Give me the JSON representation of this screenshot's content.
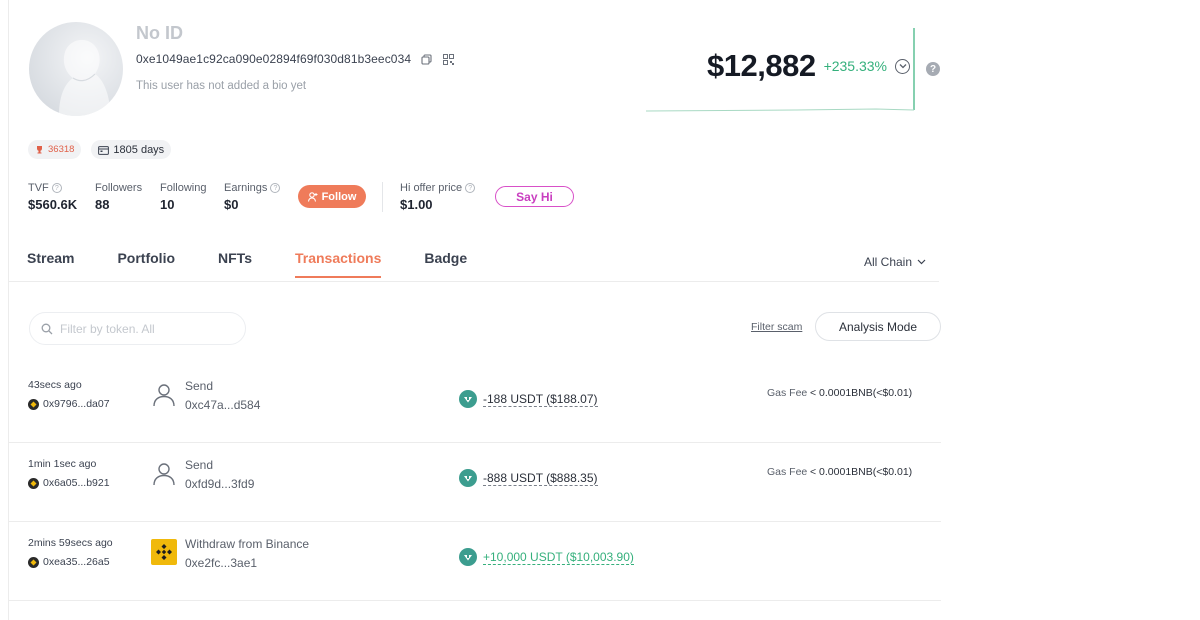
{
  "profile": {
    "name": "No ID",
    "address": "0xe1049ae1c92ca090e02894f69f030d81b3eec034",
    "bio": "This user has not added a bio yet",
    "rank": "36318",
    "days": "1805 days"
  },
  "stats": [
    {
      "label": "TVF",
      "value": "$560.6K",
      "has_help": true
    },
    {
      "label": "Followers",
      "value": "88",
      "has_help": false
    },
    {
      "label": "Following",
      "value": "10",
      "has_help": false
    },
    {
      "label": "Earnings",
      "value": "$0",
      "has_help": true
    }
  ],
  "follow_label": "Follow",
  "offer": {
    "label": "Hi offer price",
    "value": "$1.00"
  },
  "sayhi_label": "Say Hi",
  "net_worth": {
    "value": "$12,882",
    "change": "+235.33%",
    "change_color": "#35b07c"
  },
  "tabs": [
    {
      "label": "Stream",
      "active": false
    },
    {
      "label": "Portfolio",
      "active": false
    },
    {
      "label": "NFTs",
      "active": false
    },
    {
      "label": "Transactions",
      "active": true
    },
    {
      "label": "Badge",
      "active": false
    }
  ],
  "chain_selector": "All Chain",
  "search": {
    "placeholder": "Filter by token. All"
  },
  "filter_scam": "Filter scam",
  "analysis_mode": "Analysis Mode",
  "transactions": [
    {
      "time": "43secs ago",
      "from": "0x9796...da07",
      "type": "Send",
      "counterparty": "0xc47a...d584",
      "icon": "user-icon",
      "amount": "-188 USDT ($188.07)",
      "positive": false,
      "gas_label": "Gas Fee",
      "gas_value": "< 0.0001BNB(<$0.01)"
    },
    {
      "time": "1min 1sec ago",
      "from": "0x6a05...b921",
      "type": "Send",
      "counterparty": "0xfd9d...3fd9",
      "icon": "user-icon",
      "amount": "-888 USDT ($888.35)",
      "positive": false,
      "gas_label": "Gas Fee",
      "gas_value": "< 0.0001BNB(<$0.01)"
    },
    {
      "time": "2mins 59secs ago",
      "from": "0xea35...26a5",
      "type": "Withdraw from Binance",
      "counterparty": "0xe2fc...3ae1",
      "icon": "binance-icon",
      "amount": "+10,000 USDT ($10,003.90)",
      "positive": true,
      "gas_label": "",
      "gas_value": ""
    }
  ],
  "colors": {
    "accent": "#ef7b5a",
    "positive": "#35b07c",
    "sayhi": "#d850c8",
    "usdt": "#3c9d8f",
    "binance": "#f0b90b"
  }
}
